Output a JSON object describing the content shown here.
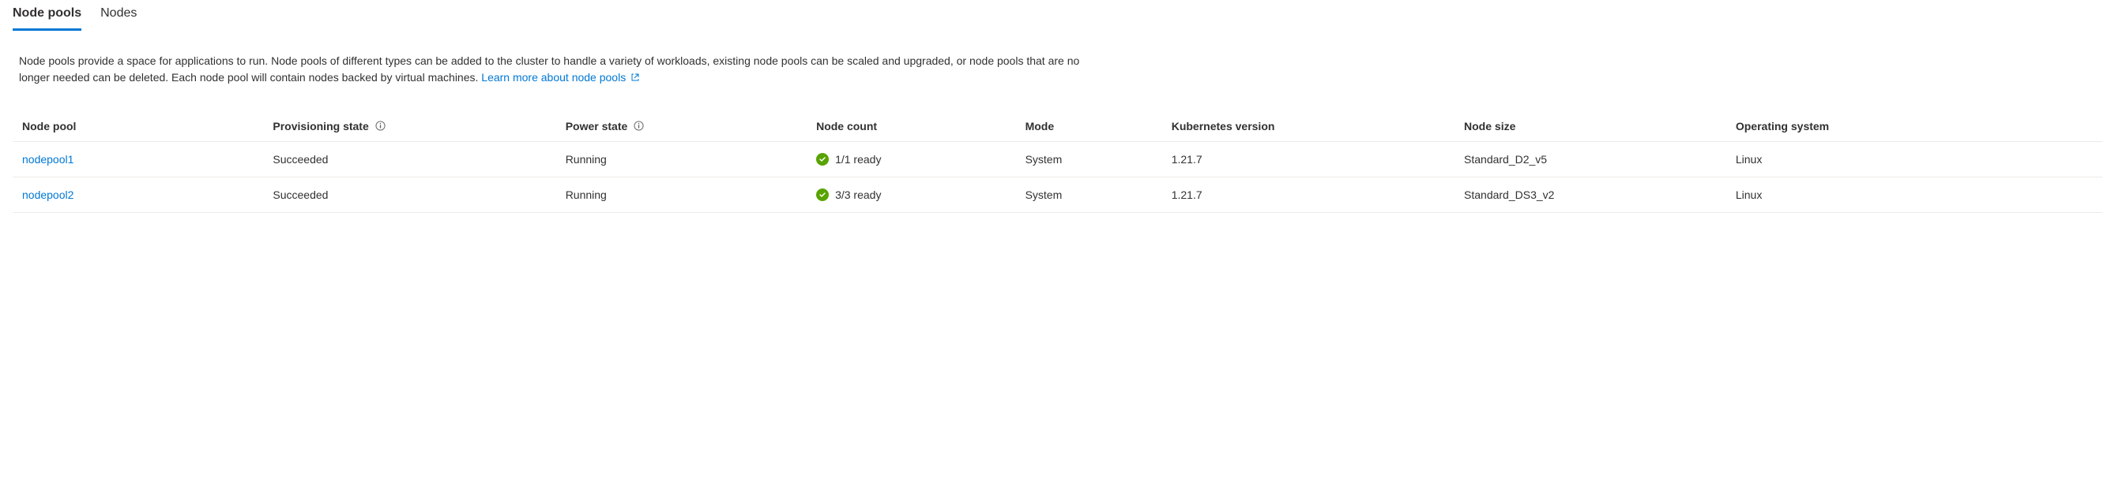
{
  "tabs": {
    "node_pools": "Node pools",
    "nodes": "Nodes"
  },
  "description": {
    "text": "Node pools provide a space for applications to run. Node pools of different types can be added to the cluster to handle a variety of workloads, existing node pools can be scaled and upgraded, or node pools that are no longer needed can be deleted. Each node pool will contain nodes backed by virtual machines.",
    "learn_more": "Learn more about node pools"
  },
  "table": {
    "headers": {
      "node_pool": "Node pool",
      "provisioning_state": "Provisioning state",
      "power_state": "Power state",
      "node_count": "Node count",
      "mode": "Mode",
      "kubernetes_version": "Kubernetes version",
      "node_size": "Node size",
      "operating_system": "Operating system"
    },
    "rows": [
      {
        "name": "nodepool1",
        "provisioning_state": "Succeeded",
        "power_state": "Running",
        "node_count": "1/1 ready",
        "mode": "System",
        "kubernetes_version": "1.21.7",
        "node_size": "Standard_D2_v5",
        "operating_system": "Linux"
      },
      {
        "name": "nodepool2",
        "provisioning_state": "Succeeded",
        "power_state": "Running",
        "node_count": "3/3 ready",
        "mode": "System",
        "kubernetes_version": "1.21.7",
        "node_size": "Standard_DS3_v2",
        "operating_system": "Linux"
      }
    ]
  }
}
